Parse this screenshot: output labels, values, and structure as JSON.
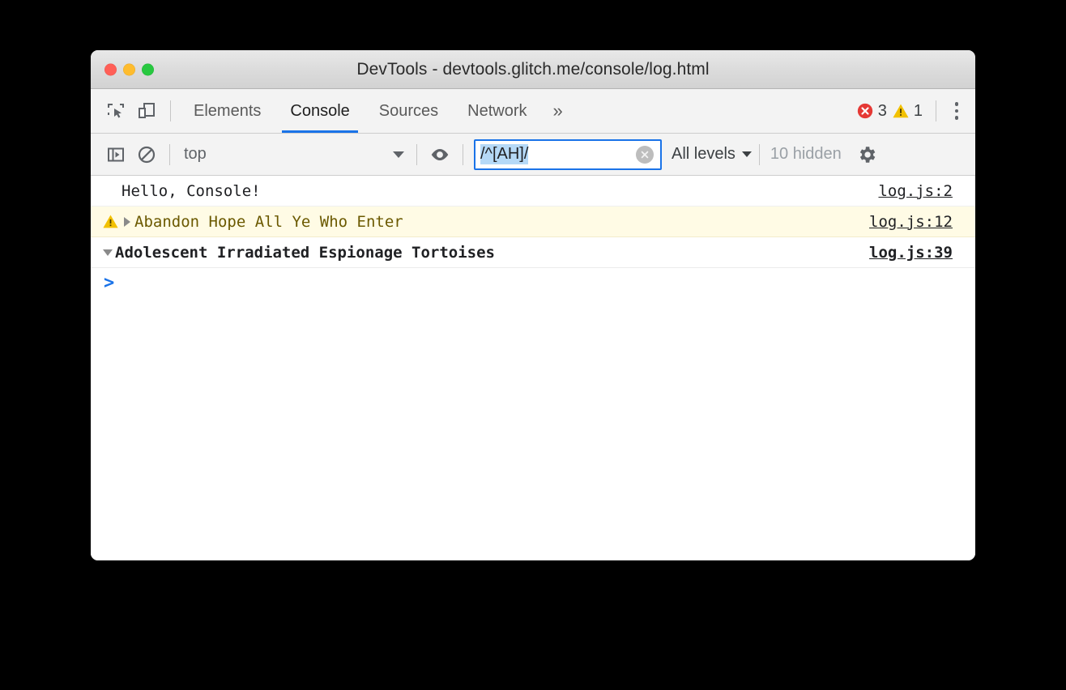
{
  "window": {
    "title": "DevTools - devtools.glitch.me/console/log.html",
    "controls": {
      "close": "close-window",
      "minimize": "minimize-window",
      "maximize": "maximize-window"
    }
  },
  "tabbar": {
    "inspect_icon": "inspect-element-icon",
    "device_icon": "device-toolbar-icon",
    "tabs": [
      {
        "label": "Elements",
        "active": false
      },
      {
        "label": "Console",
        "active": true
      },
      {
        "label": "Sources",
        "active": false
      },
      {
        "label": "Network",
        "active": false
      }
    ],
    "more_tabs": "»",
    "errors": {
      "icon": "error-icon",
      "count": "3",
      "color": "#e53935"
    },
    "warnings": {
      "icon": "warning-icon",
      "count": "1",
      "color": "#f2c100"
    },
    "menu_icon": "kebab-menu-icon"
  },
  "console_toolbar": {
    "sidebar_toggle_icon": "console-sidebar-toggle-icon",
    "clear_icon": "clear-console-icon",
    "context": {
      "value": "top",
      "caret": "chevron-down-icon"
    },
    "eye_icon": "live-expression-eye-icon",
    "filter": {
      "value": "/^[AH]/",
      "placeholder": "Filter",
      "selected": true,
      "clear_icon": "clear-filter-icon",
      "focus_color": "#1a73e8",
      "selection_color": "#b5d9f7"
    },
    "levels": {
      "label": "All levels",
      "caret": "chevron-down-icon"
    },
    "hidden": "10 hidden",
    "settings_icon": "gear-icon"
  },
  "console_messages": [
    {
      "type": "log",
      "icon": null,
      "disclosure": null,
      "text": "Hello, Console!",
      "source": "log.js:2"
    },
    {
      "type": "warning",
      "icon": "warning-icon",
      "disclosure": "collapsed",
      "text": "Abandon Hope All Ye Who Enter",
      "source": "log.js:12"
    },
    {
      "type": "group",
      "icon": null,
      "disclosure": "expanded",
      "text": "Adolescent Irradiated Espionage Tortoises",
      "source": "log.js:39"
    }
  ],
  "prompt": {
    "chevron": ">",
    "value": ""
  }
}
